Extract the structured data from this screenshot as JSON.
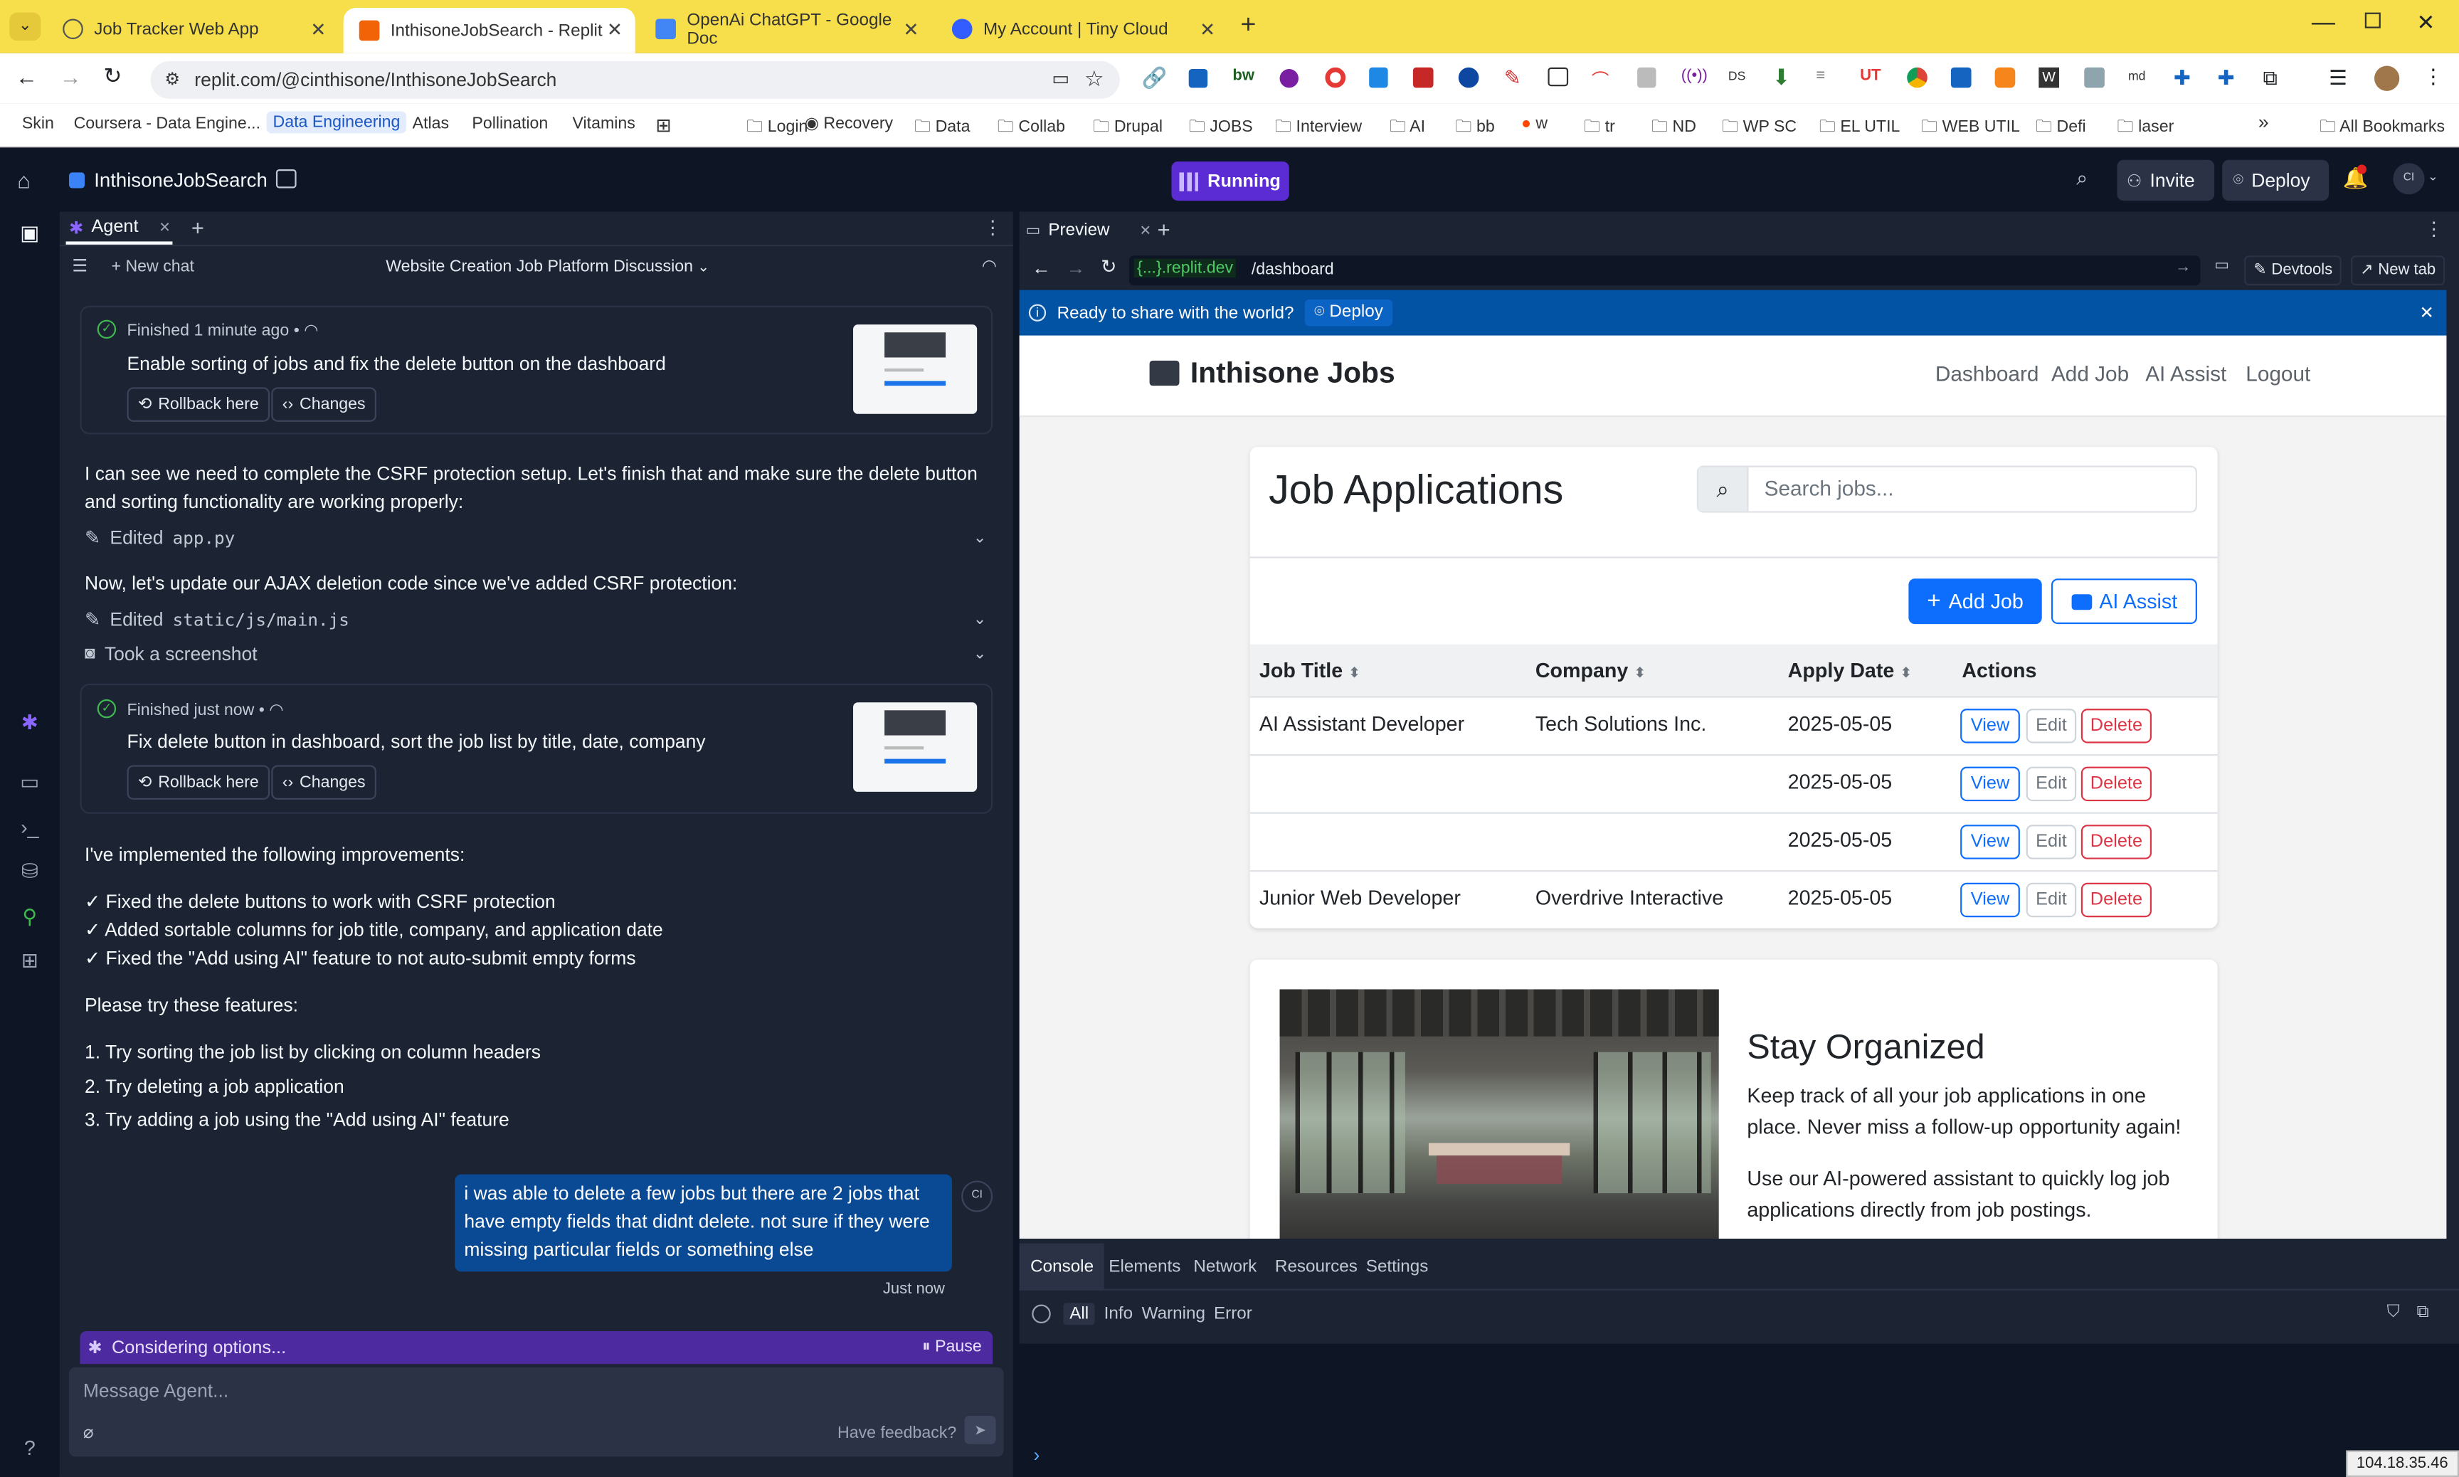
{
  "browser": {
    "tabs": [
      {
        "title": "Job Tracker Web App",
        "active": false
      },
      {
        "title": "InthisoneJobSearch - Replit",
        "active": true
      },
      {
        "title": "OpenAi ChatGPT - Google Doc",
        "active": false
      },
      {
        "title": "My Account | Tiny Cloud",
        "active": false
      }
    ],
    "url": "replit.com/@cinthisone/InthisoneJobSearch",
    "bookmarks": [
      "Skin",
      "Coursera - Data Engine...",
      "Data Engineering",
      "Atlas",
      "Pollination",
      "Vitamins"
    ],
    "bookmark_folders": [
      "Login",
      "Recovery",
      "Data",
      "Collab",
      "Drupal",
      "JOBS",
      "Interview",
      "AI",
      "bb",
      "w",
      "tr",
      "ND",
      "WP SC",
      "EL UTIL",
      "WEB UTIL",
      "Defi",
      "laser"
    ],
    "all_bookmarks": "All Bookmarks"
  },
  "replit": {
    "project_name": "InthisoneJobSearch",
    "status": "Running",
    "invite_label": "Invite",
    "deploy_label": "Deploy",
    "avatar_initials": "CI"
  },
  "agent": {
    "tab_label": "Agent",
    "new_chat": "New chat",
    "chat_title": "Website Creation Job Platform Discussion",
    "checkpoint1": {
      "status": "Finished 1 minute ago",
      "summary": "Enable sorting of jobs and fix the delete button on the dashboard",
      "rollback": "Rollback here",
      "changes": "Changes"
    },
    "msg1": "I can see we need to complete the CSRF protection setup. Let's finish that and make sure the delete button and sorting functionality are working properly:",
    "action1_prefix": "Edited",
    "action1_file": "app.py",
    "msg2": "Now, let's update our AJAX deletion code since we've added CSRF protection:",
    "action2_prefix": "Edited",
    "action2_file": "static/js/main.js",
    "action3": "Took a screenshot",
    "checkpoint2": {
      "status": "Finished just now",
      "summary": "Fix delete button in dashboard, sort the job list by title, date, company",
      "rollback": "Rollback here",
      "changes": "Changes"
    },
    "msg3": "I've implemented the following improvements:",
    "improvements": [
      "✓ Fixed the delete buttons to work with CSRF protection",
      "✓ Added sortable columns for job title, company, and application date",
      "✓ Fixed the \"Add using AI\" feature to not auto-submit empty forms"
    ],
    "msg4": "Please try these features:",
    "steps": [
      "1. Try sorting the job list by clicking on column headers",
      "2. Try deleting a job application",
      "3. Try adding a job using the \"Add using AI\" feature"
    ],
    "user_message": "i was able to delete a few jobs but there are 2 jobs that have empty fields that didnt delete. not sure if they were missing particular fields or something else",
    "user_initials": "CI",
    "user_time": "Just now",
    "thinking": "Considering options...",
    "pause": "Pause",
    "input_placeholder": "Message Agent...",
    "feedback": "Have feedback?"
  },
  "preview": {
    "tab_label": "Preview",
    "domain": "{...}.replit.dev",
    "path": "/dashboard",
    "devtools": "Devtools",
    "new_tab": "New tab",
    "share_text": "Ready to share with the world?",
    "share_deploy": "Deploy"
  },
  "site": {
    "brand": "Inthisone Jobs",
    "nav": [
      "Dashboard",
      "Add Job",
      "AI Assist",
      "Logout"
    ],
    "heading": "Job Applications",
    "search_placeholder": "Search jobs...",
    "add_job": "Add Job",
    "ai_assist": "AI Assist",
    "columns": [
      "Job Title",
      "Company",
      "Apply Date",
      "Actions"
    ],
    "rows": [
      {
        "title": "AI Assistant Developer",
        "company": "Tech Solutions Inc.",
        "date": "2025-05-05"
      },
      {
        "title": "",
        "company": "",
        "date": "2025-05-05"
      },
      {
        "title": "",
        "company": "",
        "date": "2025-05-05"
      },
      {
        "title": "Junior Web Developer",
        "company": "Overdrive Interactive",
        "date": "2025-05-05"
      }
    ],
    "actions": {
      "view": "View",
      "edit": "Edit",
      "delete": "Delete"
    },
    "promo_title": "Stay Organized",
    "promo_p1": "Keep track of all your job applications in one place. Never miss a follow-up opportunity again!",
    "promo_p2": "Use our AI-powered assistant to quickly log job applications directly from job postings."
  },
  "devtools": {
    "tabs": [
      "Console",
      "Elements",
      "Network",
      "Resources",
      "Settings"
    ],
    "filters": [
      "All",
      "Info",
      "Warning",
      "Error"
    ]
  },
  "ip_address": "104.18.35.46",
  "colors": {
    "tab_bar": "#f7df4c",
    "replit_bg": "#0e1525",
    "agent_bg": "#1c2333",
    "accent_purple": "#5b2bd4",
    "share_blue": "#0353a4",
    "bootstrap_blue": "#0d6efd",
    "danger": "#dc3545"
  }
}
